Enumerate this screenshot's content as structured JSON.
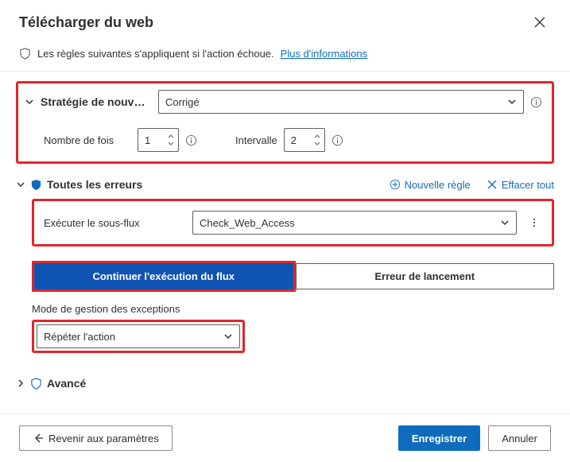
{
  "dialog": {
    "title": "Télécharger du web"
  },
  "info": {
    "text": "Les règles suivantes s'appliquent si l'action échoue.",
    "link": "Plus d'informations"
  },
  "strategy": {
    "label": "Stratégie de nouv…",
    "value": "Corrigé",
    "retries_label": "Nombre de fois",
    "retries_value": "1",
    "interval_label": "Intervalle",
    "interval_value": "2"
  },
  "errors": {
    "title": "Toutes les erreurs",
    "new_rule": "Nouvelle règle",
    "clear_all": "Effacer tout",
    "subflow_label": "Exécuter le sous-flux",
    "subflow_value": "Check_Web_Access",
    "tab_continue": "Continuer l'exécution du flux",
    "tab_throw": "Erreur de lancement",
    "exception_mode_label": "Mode de gestion des exceptions",
    "exception_mode_value": "Répéter l'action"
  },
  "advanced": {
    "title": "Avancé"
  },
  "footer": {
    "back": "Revenir aux paramètres",
    "save": "Enregistrer",
    "cancel": "Annuler"
  }
}
